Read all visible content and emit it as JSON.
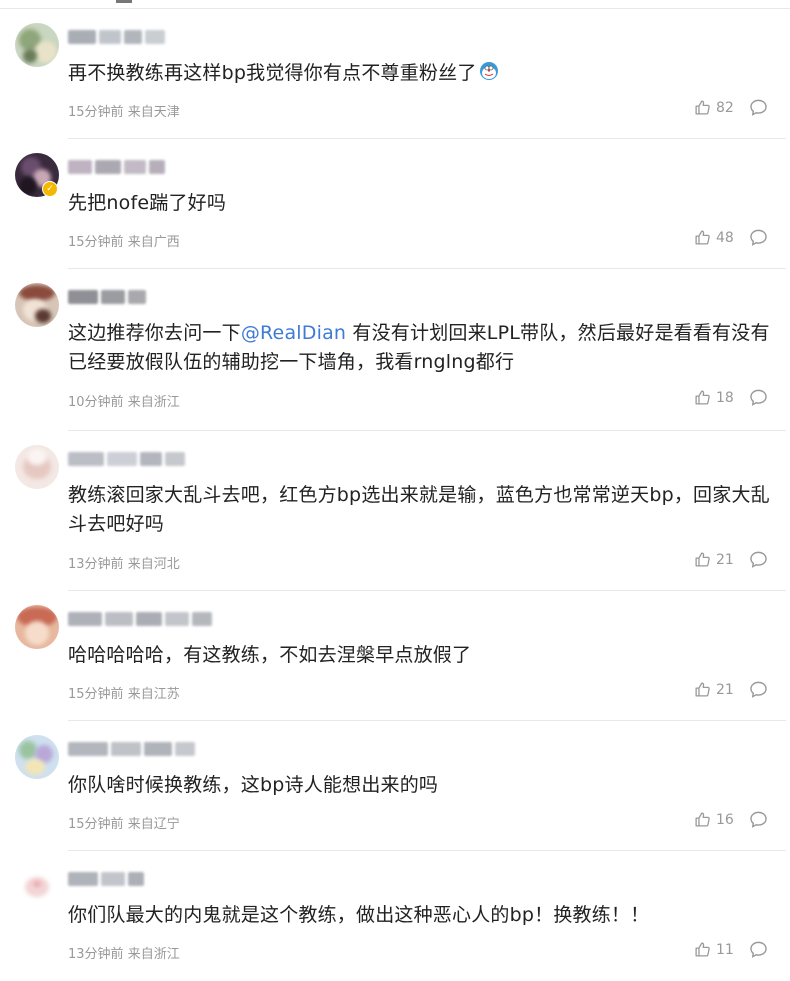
{
  "comments": [
    {
      "text": "再不换教练再这样bp我觉得你有点不尊重粉丝了",
      "emoji": "doraemon-emoji",
      "time": "15分钟前",
      "location": "来自天津",
      "likes": "82",
      "verified": false
    },
    {
      "text": "先把nofe踹了好吗",
      "time": "15分钟前",
      "location": "来自广西",
      "likes": "48",
      "verified": true
    },
    {
      "text_before": "这边推荐你去问一下",
      "mention": "@RealDian",
      "text_after": " 有没有计划回来LPL带队，然后最好是看看有没有已经要放假队伍的辅助挖一下墙角，我看rnglng都行",
      "time": "10分钟前",
      "location": "来自浙江",
      "likes": "18",
      "verified": false
    },
    {
      "text": "教练滚回家大乱斗去吧，红色方bp选出来就是输，蓝色方也常常逆天bp，回家大乱斗去吧好吗",
      "time": "13分钟前",
      "location": "来自河北",
      "likes": "21",
      "verified": false
    },
    {
      "text": "哈哈哈哈哈，有这教练，不如去涅槃早点放假了",
      "time": "15分钟前",
      "location": "来自江苏",
      "likes": "21",
      "verified": false
    },
    {
      "text": "你队啥时候换教练，这bp诗人能想出来的吗",
      "time": "15分钟前",
      "location": "来自辽宁",
      "likes": "16",
      "verified": false
    },
    {
      "text": "你们队最大的内鬼就是这个教练，做出这种恶心人的bp！换教练！！",
      "time": "13分钟前",
      "location": "来自浙江",
      "likes": "11",
      "verified": false
    }
  ],
  "icons": {
    "like": "thumbs-up-icon",
    "reply": "comment-bubble-icon"
  },
  "colors": {
    "mention": "#3e7bd6",
    "meta": "#999999",
    "text": "#222222",
    "divider": "#e8e8e8",
    "verified_badge": "#f5b800"
  }
}
